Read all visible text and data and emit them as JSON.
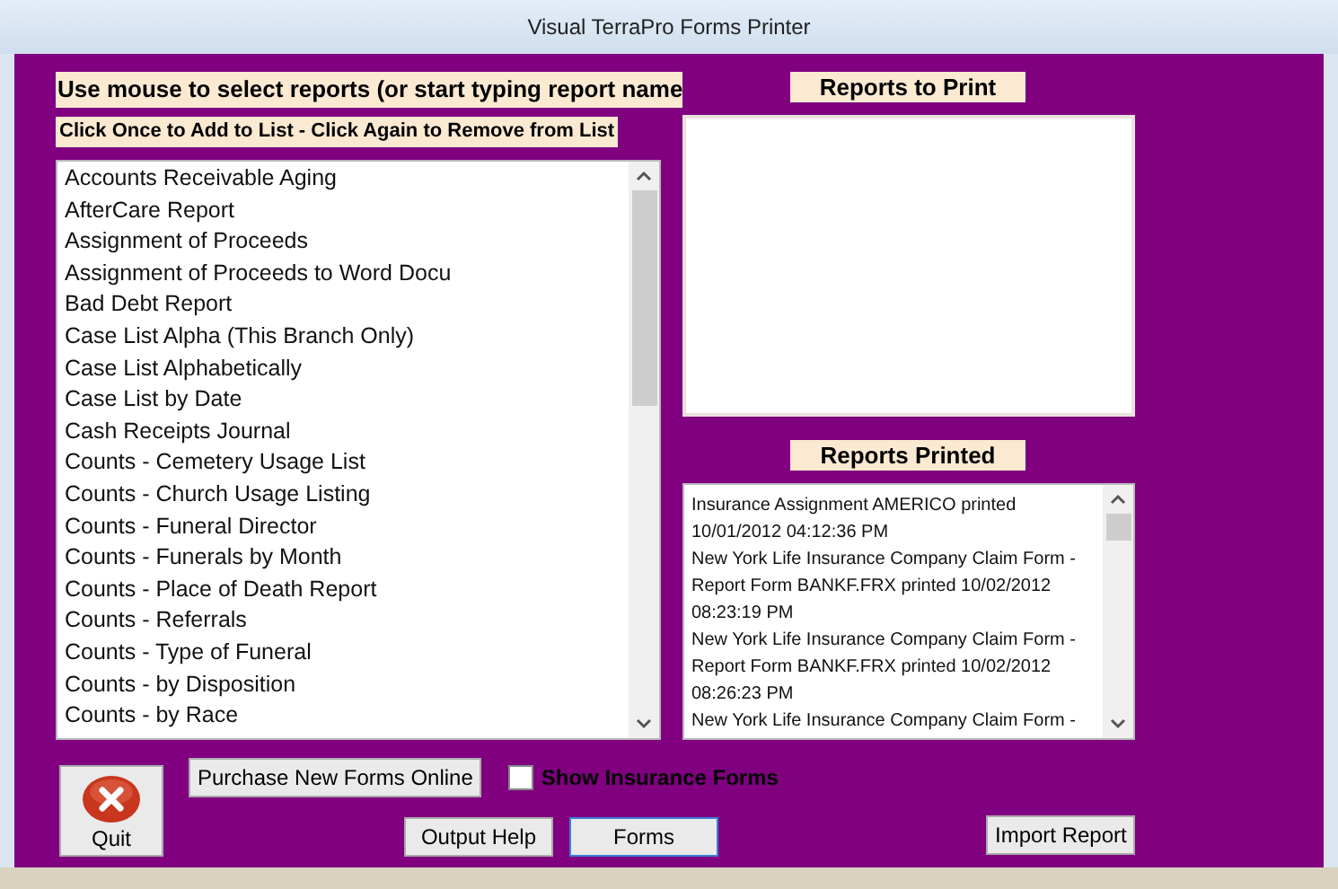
{
  "window": {
    "title": "Visual TerraPro Forms Printer"
  },
  "instructions": [
    "Use mouse to select reports (or start typing report name",
    "Click Once to Add to List - Click Again to Remove from List"
  ],
  "reports": [
    "Accounts Receivable Aging",
    "AfterCare Report",
    "Assignment of Proceeds",
    "Assignment of Proceeds to Word Docu",
    "Bad Debt Report",
    "Case List Alpha (This Branch Only)",
    "Case List Alphabetically",
    "Case List by Date",
    "Cash Receipts Journal",
    "Counts - Cemetery Usage List",
    "Counts - Church Usage Listing",
    "Counts - Funeral Director",
    "Counts - Funerals by Month",
    "Counts - Place of Death Report",
    "Counts - Referrals",
    "Counts - Type of Funeral",
    "Counts - by Disposition",
    "Counts - by Race"
  ],
  "reports_to_print": {
    "title": "Reports to Print"
  },
  "reports_printed": {
    "title": "Reports Printed",
    "entries": [
      "Insurance Assignment AMERICO printed 10/01/2012 04:12:36 PM",
      "New York Life Insurance Company Claim Form - Report Form BANKF.FRX printed 10/02/2012 08:23:19 PM",
      "New York Life Insurance Company Claim Form - Report Form BANKF.FRX printed 10/02/2012 08:26:23 PM",
      "New York Life Insurance Company Claim Form -"
    ]
  },
  "quit_button": {
    "label": "Quit"
  },
  "purchase_button": {
    "label": "Purchase New Forms Online"
  },
  "show_insurance_forms": {
    "label": "Show Insurance Forms",
    "checked": false
  },
  "buttons": [
    {
      "label": "Output Help",
      "focused": false
    },
    {
      "label": "Forms",
      "focused": true
    }
  ],
  "import_button": {
    "label": "Import Report"
  }
}
